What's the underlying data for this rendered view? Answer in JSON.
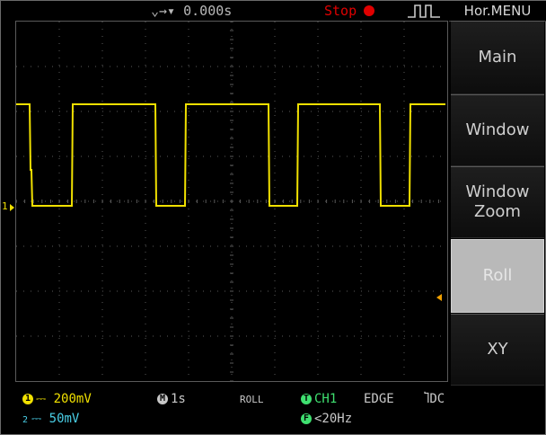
{
  "header": {
    "trigger_position": "⌄→▾ 0.000s",
    "status": "Stop",
    "menu_title": "Hor.MENU"
  },
  "menu": {
    "items": [
      {
        "label": "Main",
        "active": false
      },
      {
        "label": "Window",
        "active": false
      },
      {
        "label": "Window\nZoom",
        "active": false
      },
      {
        "label": "Roll",
        "active": true
      },
      {
        "label": "XY",
        "active": false
      }
    ]
  },
  "status_bar": {
    "ch1_scale": "200mV",
    "ch1_number": "1",
    "ch2_scale": "50mV",
    "ch2_number": "2",
    "timebase_icon": "M",
    "timebase": "1s",
    "mode": "ROLL",
    "trigger_icon": "T",
    "trigger_source": "CH1",
    "trigger_type": "EDGE",
    "coupling": "DC",
    "freq_icon": "F",
    "frequency": "<20Hz"
  },
  "screen": {
    "ch1_marker": "1",
    "trace_color": "#f0e000",
    "grid_color": "#5a5a5a"
  }
}
